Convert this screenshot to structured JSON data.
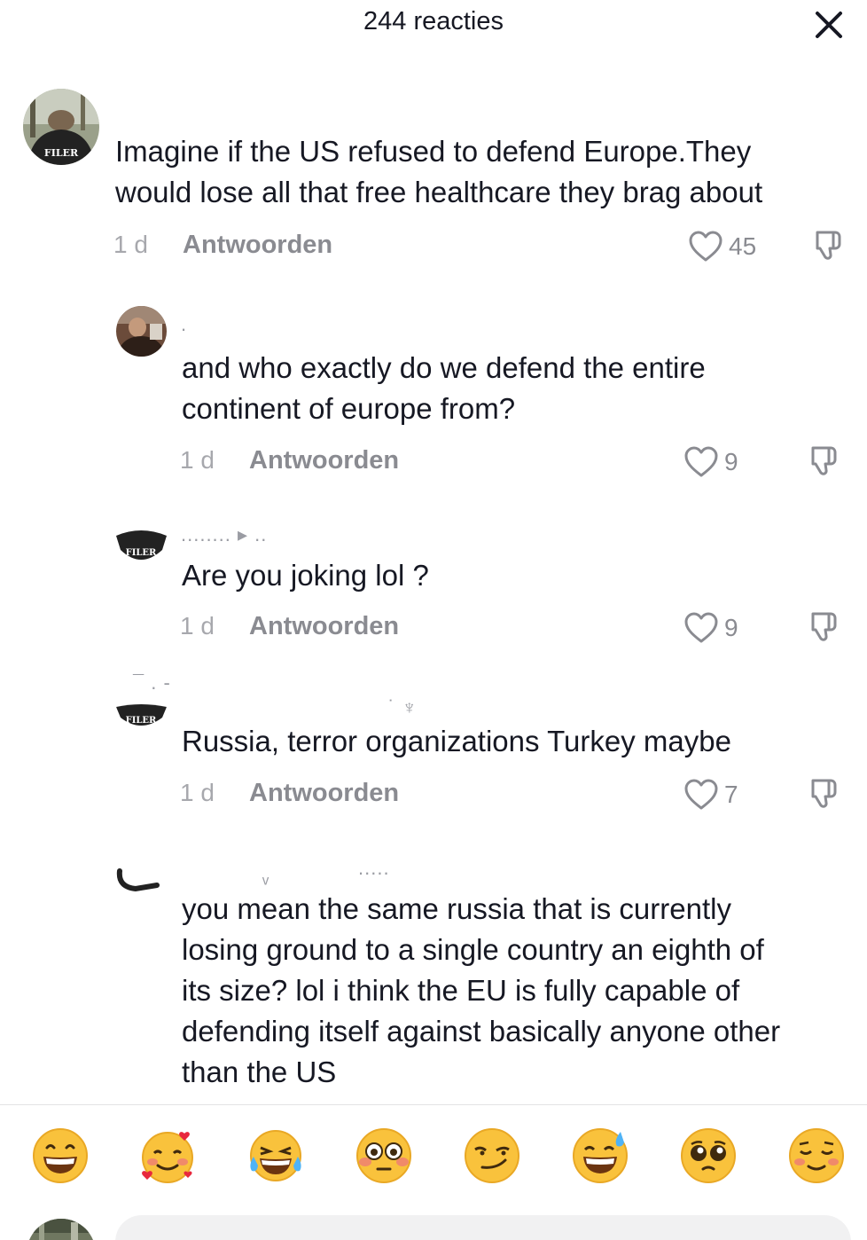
{
  "header": {
    "title": "244 reacties"
  },
  "comments": [
    {
      "text_lines": [
        "Imagine if the US refused to defend Europe.They",
        "would lose all that free healthcare they brag about"
      ],
      "time": "1 d",
      "reply_label": "Antwoorden",
      "likes": "45"
    },
    {
      "text_lines": [
        "and who exactly do we defend the entire",
        "continent of europe from?"
      ],
      "time": "1 d",
      "reply_label": "Antwoorden",
      "likes": "9"
    },
    {
      "text_lines": [
        "Are you joking lol ?"
      ],
      "time": "1 d",
      "reply_label": "Antwoorden",
      "likes": "9"
    },
    {
      "text_lines": [
        "Russia, terror organizations Turkey maybe"
      ],
      "time": "1 d",
      "reply_label": "Antwoorden",
      "likes": "7"
    },
    {
      "text_lines": [
        "you mean the same russia that is currently",
        "losing ground to a single country an eighth of",
        "its size? lol i think the EU is fully capable of",
        "defending itself against basically anyone other",
        "than the US"
      ]
    }
  ],
  "emoji_bar": [
    "grinning-emoji",
    "smiling-hearts-emoji",
    "tears-of-joy-emoji",
    "flushed-emoji",
    "smirking-emoji",
    "sweat-smile-emoji",
    "pleading-emoji",
    "relieved-emoji"
  ],
  "colors": {
    "text": "#161823",
    "muted": "#8a8b91",
    "emoji_yellow": "#f9c23c"
  }
}
